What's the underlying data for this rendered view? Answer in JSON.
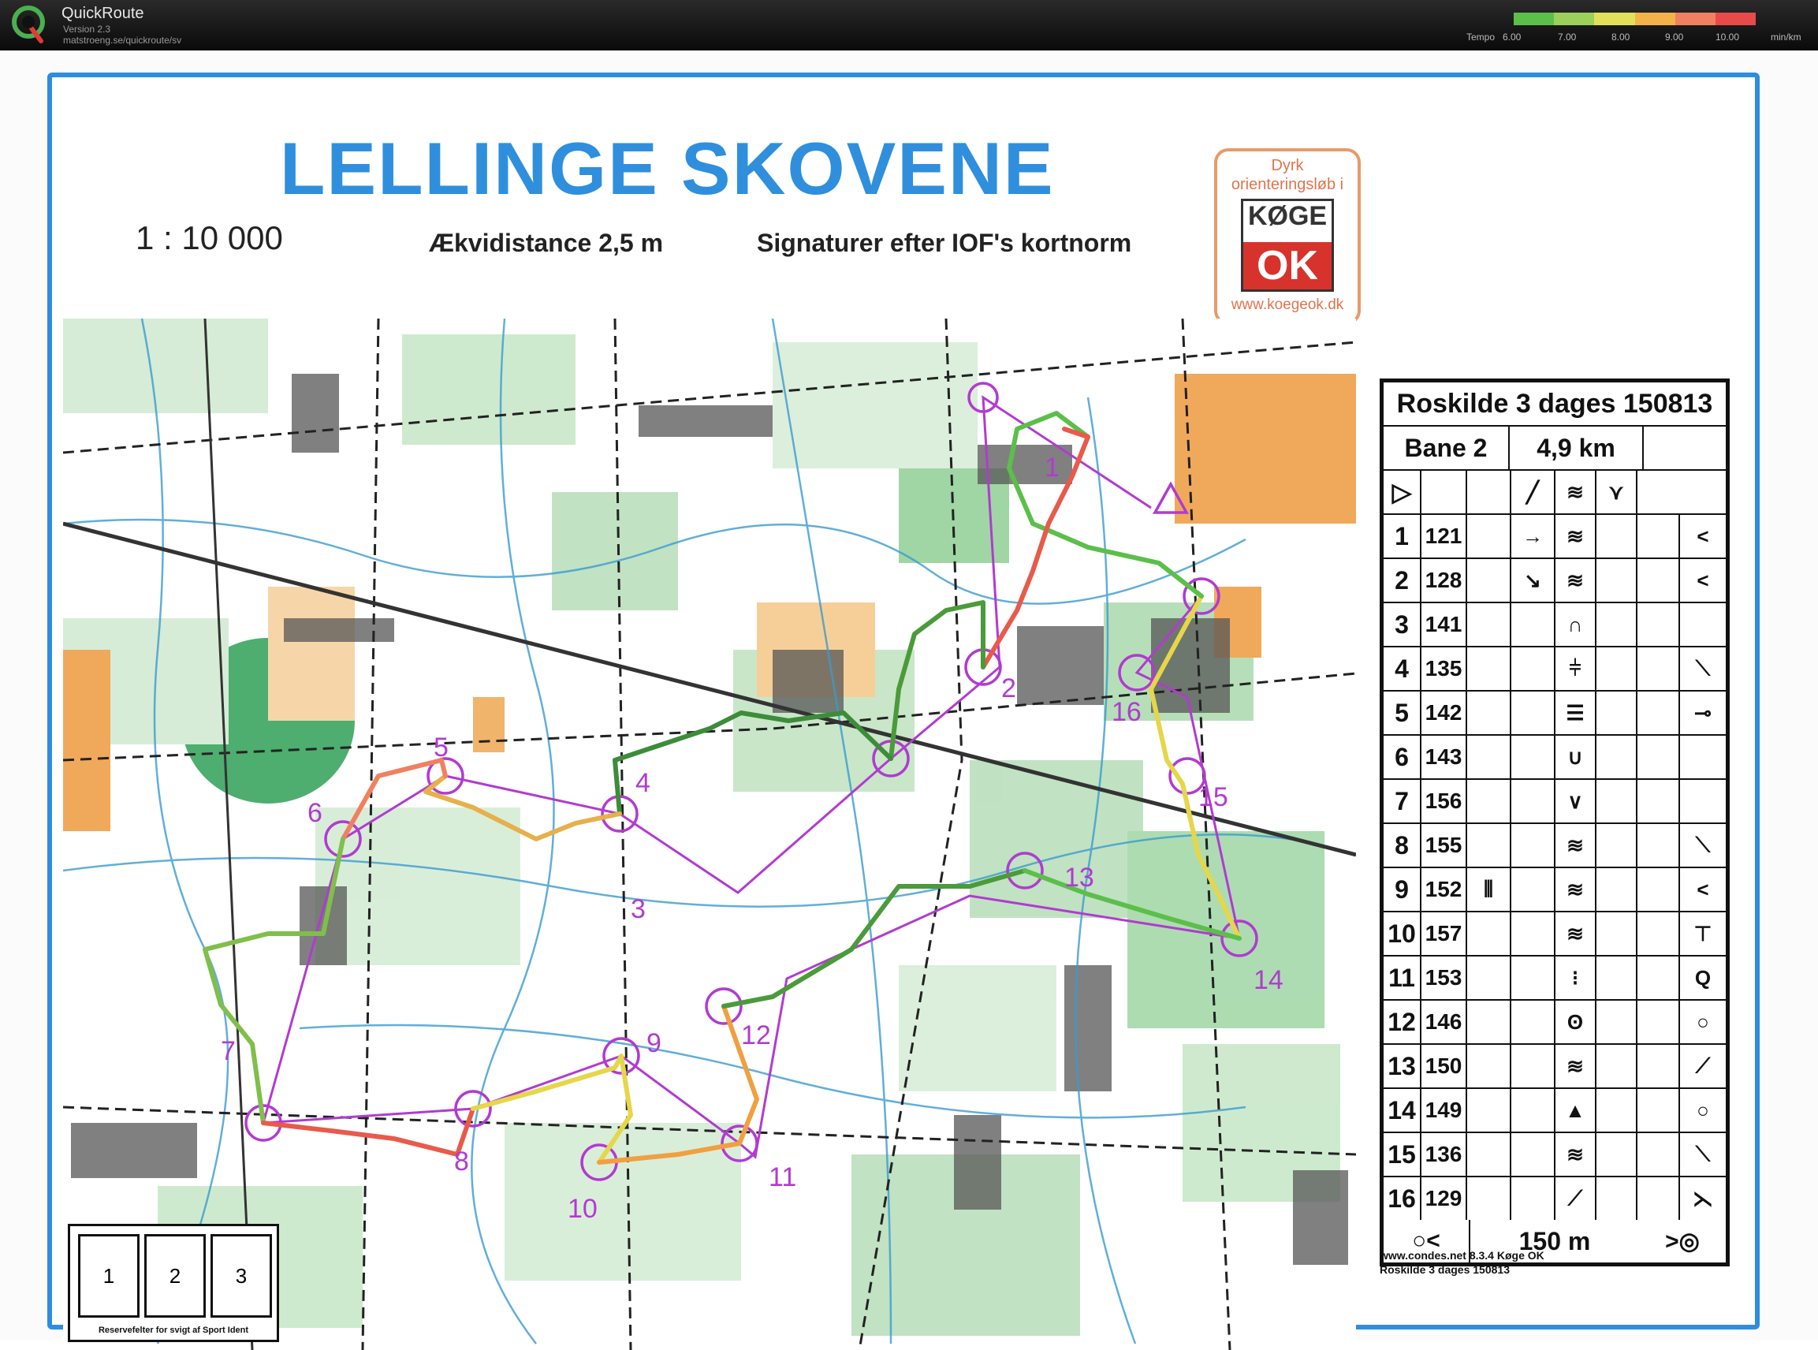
{
  "app": {
    "name": "QuickRoute",
    "version": "Version 2.3",
    "url": "matstroeng.se/quickroute/sv"
  },
  "legend": {
    "label": "Tempo",
    "ticks": [
      "6.00",
      "7.00",
      "8.00",
      "9.00",
      "10.00"
    ],
    "unit": "min/km",
    "colors": [
      "#5bbf4a",
      "#9bd05a",
      "#e2e05a",
      "#f3b24a",
      "#f08060",
      "#e84a4a"
    ]
  },
  "map": {
    "title": "LELLINGE SKOVENE",
    "scale": "1 : 10 000",
    "equidistance": "Ækvidistance 2,5 m",
    "symbols_note": "Signaturer efter IOF's kortnorm",
    "club": {
      "tagline_1": "Dyrk",
      "tagline_2": "orienteringsløb i",
      "logo_top": "KØGE",
      "logo_bottom": "OK",
      "url": "www.koegeok.dk"
    },
    "control_labels": [
      "1",
      "2",
      "3",
      "4",
      "5",
      "6",
      "7",
      "8",
      "9",
      "10",
      "11",
      "12",
      "13",
      "14",
      "15",
      "16"
    ],
    "reserve": {
      "boxes": [
        "1",
        "2",
        "3"
      ],
      "caption": "Reservefelter for svigt af Sport Ident"
    }
  },
  "description_sheet": {
    "event": "Roskilde 3 dages 150813",
    "course": "Bane 2",
    "length": "4,9 km",
    "start_symbols": [
      "▷",
      "",
      "",
      "╱",
      "≋",
      "⋎"
    ],
    "controls": [
      {
        "num": "1",
        "code": "121",
        "c": "",
        "d": "→",
        "e": "≋",
        "f": "",
        "g": "",
        "h": "<"
      },
      {
        "num": "2",
        "code": "128",
        "c": "",
        "d": "↘",
        "e": "≋",
        "f": "",
        "g": "",
        "h": "<"
      },
      {
        "num": "3",
        "code": "141",
        "c": "",
        "d": "",
        "e": "∩",
        "f": "",
        "g": "",
        "h": ""
      },
      {
        "num": "4",
        "code": "135",
        "c": "",
        "d": "",
        "e": "⫩",
        "f": "",
        "g": "",
        "h": "⟍"
      },
      {
        "num": "5",
        "code": "142",
        "c": "",
        "d": "",
        "e": "☰",
        "f": "",
        "g": "",
        "h": "⊸"
      },
      {
        "num": "6",
        "code": "143",
        "c": "",
        "d": "",
        "e": "∪",
        "f": "",
        "g": "",
        "h": ""
      },
      {
        "num": "7",
        "code": "156",
        "c": "",
        "d": "",
        "e": "∨",
        "f": "",
        "g": "",
        "h": ""
      },
      {
        "num": "8",
        "code": "155",
        "c": "",
        "d": "",
        "e": "≋",
        "f": "",
        "g": "",
        "h": "⟍"
      },
      {
        "num": "9",
        "code": "152",
        "c": "⫴",
        "d": "",
        "e": "≋",
        "f": "",
        "g": "",
        "h": "<"
      },
      {
        "num": "10",
        "code": "157",
        "c": "",
        "d": "",
        "e": "≋",
        "f": "",
        "g": "",
        "h": "⊤"
      },
      {
        "num": "11",
        "code": "153",
        "c": "",
        "d": "",
        "e": "⁝",
        "f": "",
        "g": "",
        "h": "Q"
      },
      {
        "num": "12",
        "code": "146",
        "c": "",
        "d": "",
        "e": "ʘ",
        "f": "",
        "g": "",
        "h": "○"
      },
      {
        "num": "13",
        "code": "150",
        "c": "",
        "d": "",
        "e": "≋",
        "f": "",
        "g": "",
        "h": "⟋"
      },
      {
        "num": "14",
        "code": "149",
        "c": "",
        "d": "",
        "e": "▲",
        "f": "",
        "g": "",
        "h": "○"
      },
      {
        "num": "15",
        "code": "136",
        "c": "",
        "d": "",
        "e": "≋",
        "f": "",
        "g": "",
        "h": "⟍"
      },
      {
        "num": "16",
        "code": "129",
        "c": "",
        "d": "",
        "e": "⟋",
        "f": "",
        "g": "",
        "h": "⋋"
      }
    ],
    "finish": {
      "left": "○<",
      "distance": "150 m",
      "right": ">◎"
    },
    "footer_1": "www.condes.net 8.3.4 Køge OK",
    "footer_2": "Roskilde 3 dages 150813"
  }
}
